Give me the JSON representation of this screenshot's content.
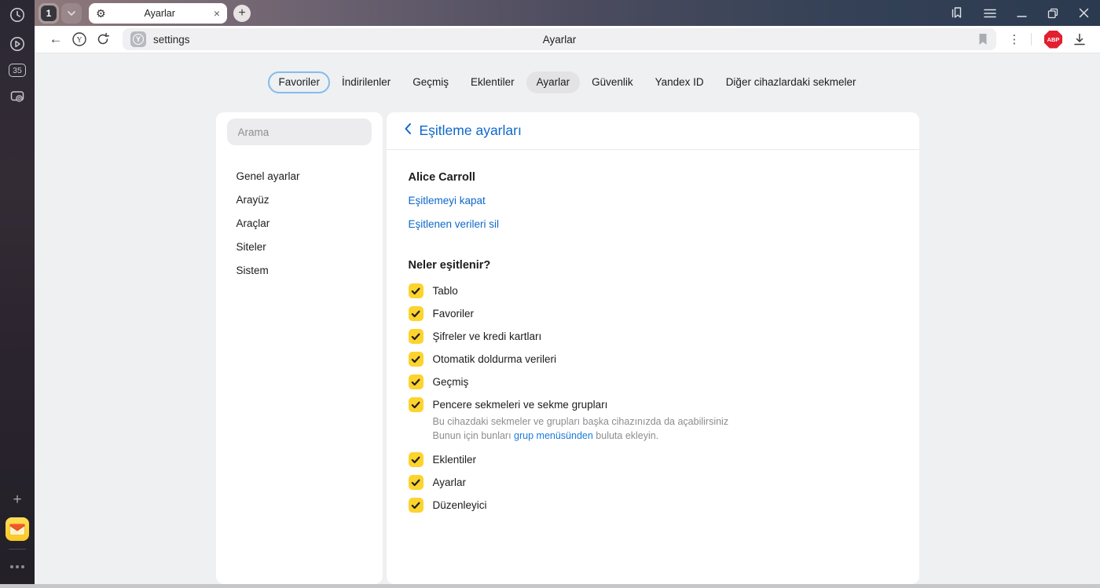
{
  "chrome": {
    "side_rail": {
      "tab_counter": "35",
      "icon_names": [
        "history-clock-icon",
        "video-play-icon",
        "tab-counter-badge",
        "screenshot-camera-icon",
        "add-panel-icon",
        "yandex-mail-icon",
        "more-options-icon"
      ]
    },
    "title_bar": {
      "tab_group_count": "1",
      "active_tab_title": "Ayarlar",
      "icon_names": [
        "tab-group-chevron-icon",
        "tab-gear-icon",
        "tab-close-icon",
        "new-tab-plus-icon",
        "bookmarks-panel-icon",
        "menu-icon",
        "window-minimize-icon",
        "window-restore-icon",
        "window-close-icon"
      ]
    },
    "toolbar": {
      "url_text": "settings",
      "page_title": "Ayarlar",
      "extension_badge": "ABP",
      "icon_names": [
        "back-arrow-icon",
        "yandex-circle-icon",
        "refresh-icon",
        "site-favicon",
        "bookmark-flag-icon",
        "kebab-menu-icon",
        "adblock-badge",
        "download-icon"
      ]
    }
  },
  "glyphs": {
    "back": "←",
    "gear": "⚙",
    "close": "×",
    "plus": "+",
    "kebab": "⋮",
    "yandex_letter": "Y",
    "back_chevron": "‹"
  },
  "settings_tabs": {
    "items": [
      {
        "label": "Favoriler",
        "style": "outlined"
      },
      {
        "label": "İndirilenler",
        "style": "plain"
      },
      {
        "label": "Geçmiş",
        "style": "plain"
      },
      {
        "label": "Eklentiler",
        "style": "plain"
      },
      {
        "label": "Ayarlar",
        "style": "active"
      },
      {
        "label": "Güvenlik",
        "style": "plain"
      },
      {
        "label": "Yandex ID",
        "style": "plain"
      },
      {
        "label": "Diğer cihazlardaki sekmeler",
        "style": "plain"
      }
    ]
  },
  "settings_nav": {
    "search_placeholder": "Arama",
    "items": [
      "Genel ayarlar",
      "Arayüz",
      "Araçlar",
      "Siteler",
      "Sistem"
    ]
  },
  "sync_panel": {
    "title": "Eşitleme ayarları",
    "account_name": "Alice Carroll",
    "turn_off_link": "Eşitlemeyi kapat",
    "delete_data_link": "Eşitlenen verileri sil",
    "section_title": "Neler eşitlenir?",
    "items": [
      {
        "label": "Tablo",
        "checked": true
      },
      {
        "label": "Favoriler",
        "checked": true
      },
      {
        "label": "Şifreler ve kredi kartları",
        "checked": true
      },
      {
        "label": "Otomatik doldurma verileri",
        "checked": true
      },
      {
        "label": "Geçmiş",
        "checked": true
      },
      {
        "label": "Pencere sekmeleri ve sekme grupları",
        "checked": true,
        "description_line1": "Bu cihazdaki sekmeler ve grupları başka cihazınızda da açabilirsiniz",
        "description_line2_prefix": "Bunun için bunları ",
        "description_link": "grup menüsünden",
        "description_suffix": " buluta ekleyin."
      },
      {
        "label": "Eklentiler",
        "checked": true
      },
      {
        "label": "Ayarlar",
        "checked": true
      },
      {
        "label": "Düzenleyici",
        "checked": true
      }
    ]
  },
  "colors": {
    "accent_blue": "#0e68c9",
    "checkbox_yellow": "#fdd32e",
    "titlebar_gradient_left": "#8e797b",
    "titlebar_gradient_right": "#2c3a50",
    "abp_red": "#e31e30",
    "page_background": "#eef0f2",
    "active_pill": "#e3e3e6",
    "outlined_pill_border": "#86bbec"
  }
}
